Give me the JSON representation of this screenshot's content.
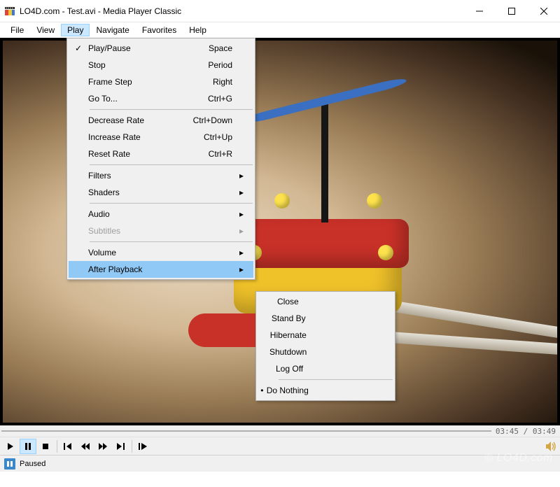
{
  "titlebar": {
    "title": "LO4D.com - Test.avi - Media Player Classic"
  },
  "menubar": {
    "items": [
      "File",
      "View",
      "Play",
      "Navigate",
      "Favorites",
      "Help"
    ],
    "open_index": 2
  },
  "play_menu": {
    "items": [
      {
        "label": "Play/Pause",
        "shortcut": "Space",
        "checked": true
      },
      {
        "label": "Stop",
        "shortcut": "Period"
      },
      {
        "label": "Frame Step",
        "shortcut": "Right"
      },
      {
        "label": "Go To...",
        "shortcut": "Ctrl+G"
      },
      {
        "sep": true
      },
      {
        "label": "Decrease Rate",
        "shortcut": "Ctrl+Down"
      },
      {
        "label": "Increase Rate",
        "shortcut": "Ctrl+Up"
      },
      {
        "label": "Reset Rate",
        "shortcut": "Ctrl+R"
      },
      {
        "sep": true
      },
      {
        "label": "Filters",
        "submenu": true
      },
      {
        "label": "Shaders",
        "submenu": true
      },
      {
        "sep": true
      },
      {
        "label": "Audio",
        "submenu": true
      },
      {
        "label": "Subtitles",
        "submenu": true,
        "disabled": true
      },
      {
        "sep": true
      },
      {
        "label": "Volume",
        "submenu": true
      },
      {
        "label": "After Playback",
        "submenu": true,
        "highlight": true
      }
    ]
  },
  "after_menu": {
    "items": [
      {
        "label": "Close"
      },
      {
        "label": "Stand By"
      },
      {
        "label": "Hibernate"
      },
      {
        "label": "Shutdown"
      },
      {
        "label": "Log Off"
      },
      {
        "sep": true
      },
      {
        "label": "Do Nothing",
        "bullet": true
      }
    ]
  },
  "seek": {
    "time": "03:45 / 03:49"
  },
  "status": {
    "text": "Paused"
  },
  "watermark": "© LO4D.com"
}
